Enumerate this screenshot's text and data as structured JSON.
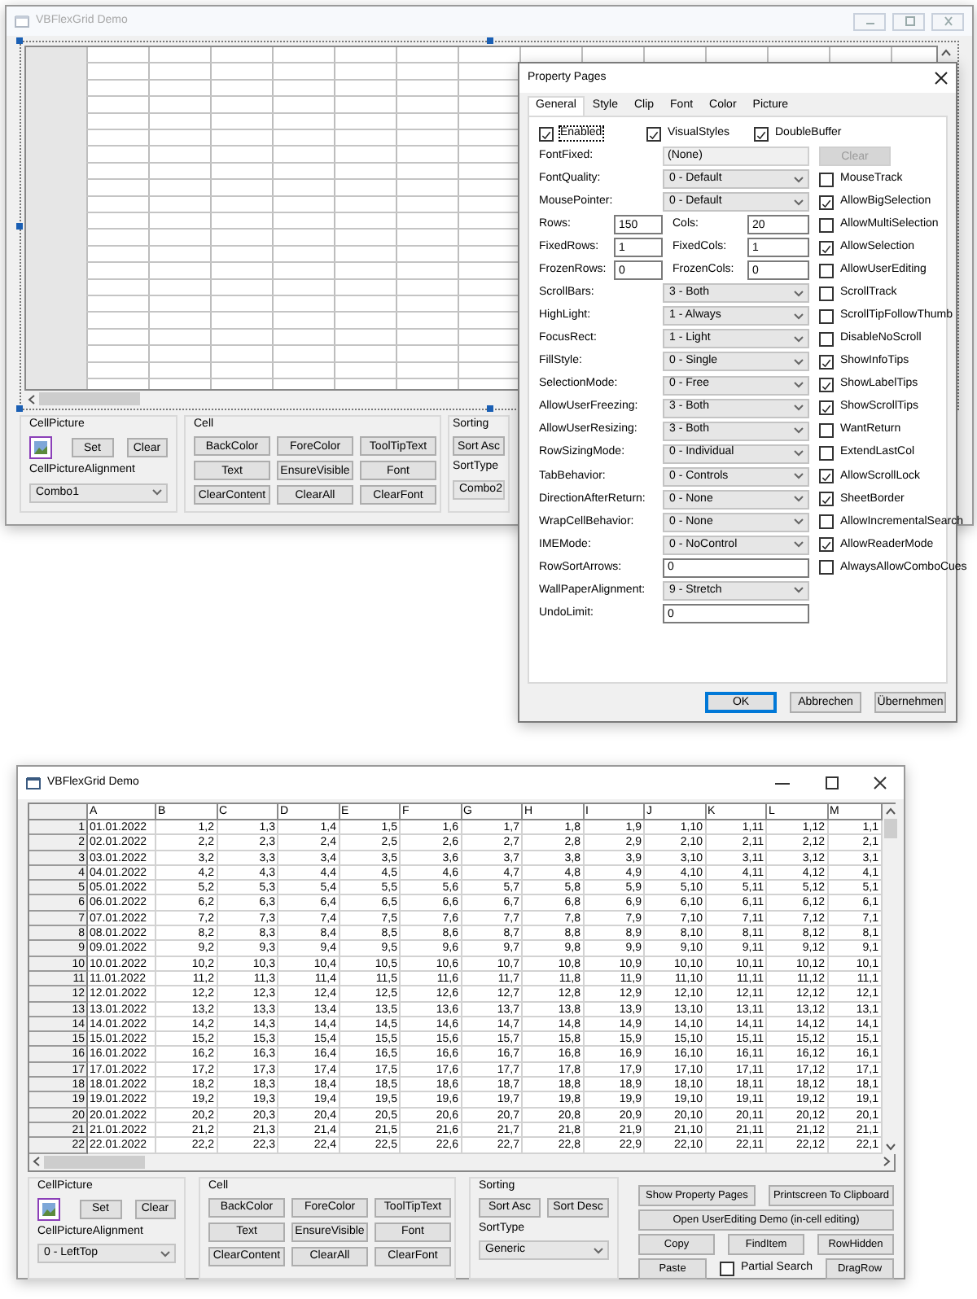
{
  "designer_window": {
    "title": "VBFlexGrid Demo",
    "cell_picture": {
      "label": "CellPicture",
      "buttons": [
        "Set",
        "Clear"
      ],
      "alignment_label": "CellPictureAlignment",
      "alignment_value": "Combo1"
    },
    "cell": {
      "label": "Cell",
      "buttons": [
        "BackColor",
        "ForeColor",
        "ToolTipText",
        "Text",
        "EnsureVisible",
        "Font",
        "ClearContent",
        "ClearAll",
        "ClearFont"
      ]
    },
    "sorting": {
      "label": "Sorting",
      "buttons": [
        "Sort Asc"
      ],
      "sort_type_label": "SortType",
      "sort_type_value": "Combo2"
    }
  },
  "property_pages": {
    "title": "Property Pages",
    "tabs": [
      {
        "label": "General",
        "selected": true
      },
      {
        "label": "Style",
        "selected": false
      },
      {
        "label": "Clip",
        "selected": false
      },
      {
        "label": "Font",
        "selected": false
      },
      {
        "label": "Color",
        "selected": false
      },
      {
        "label": "Picture",
        "selected": false
      }
    ],
    "top_checks": [
      {
        "label": "Enabled",
        "checked": true,
        "focused": true
      },
      {
        "label": "VisualStyles",
        "checked": true,
        "focused": false
      },
      {
        "label": "DoubleBuffer",
        "checked": true,
        "focused": false
      }
    ],
    "properties": [
      {
        "kind": "text",
        "label": "FontFixed:",
        "value": "(None)"
      },
      {
        "kind": "select",
        "label": "FontQuality:",
        "value": "0 - Default"
      },
      {
        "kind": "select",
        "label": "MousePointer:",
        "value": "0 - Default"
      },
      {
        "kind": "pair",
        "label": "Rows:",
        "value": "150",
        "label2": "Cols:",
        "value2": "20"
      },
      {
        "kind": "pair",
        "label": "FixedRows:",
        "value": "1",
        "label2": "FixedCols:",
        "value2": "1"
      },
      {
        "kind": "pair",
        "label": "FrozenRows:",
        "value": "0",
        "label2": "FrozenCols:",
        "value2": "0"
      },
      {
        "kind": "select",
        "label": "ScrollBars:",
        "value": "3 - Both"
      },
      {
        "kind": "select",
        "label": "HighLight:",
        "value": "1 - Always"
      },
      {
        "kind": "select",
        "label": "FocusRect:",
        "value": "1 - Light"
      },
      {
        "kind": "select",
        "label": "FillStyle:",
        "value": "0 - Single"
      },
      {
        "kind": "select",
        "label": "SelectionMode:",
        "value": "0 - Free"
      },
      {
        "kind": "select",
        "label": "AllowUserFreezing:",
        "value": "3 - Both"
      },
      {
        "kind": "select",
        "label": "AllowUserResizing:",
        "value": "3 - Both"
      },
      {
        "kind": "select",
        "label": "RowSizingMode:",
        "value": "0 - Individual"
      },
      {
        "kind": "select",
        "label": "TabBehavior:",
        "value": "0 - Controls"
      },
      {
        "kind": "select",
        "label": "DirectionAfterReturn:",
        "value": "0 - None"
      },
      {
        "kind": "select",
        "label": "WrapCellBehavior:",
        "value": "0 - None"
      },
      {
        "kind": "select",
        "label": "IMEMode:",
        "value": "0 - NoControl"
      },
      {
        "kind": "number",
        "label": "RowSortArrows:",
        "value": "0"
      },
      {
        "kind": "select",
        "label": "WallPaperAlignment:",
        "value": "9 - Stretch"
      },
      {
        "kind": "number",
        "label": "UndoLimit:",
        "value": "0"
      }
    ],
    "clear_button": {
      "label": "Clear",
      "disabled": true
    },
    "options": [
      {
        "label": "MouseTrack",
        "checked": false
      },
      {
        "label": "AllowBigSelection",
        "checked": true
      },
      {
        "label": "AllowMultiSelection",
        "checked": false
      },
      {
        "label": "AllowSelection",
        "checked": true
      },
      {
        "label": "AllowUserEditing",
        "checked": false
      },
      {
        "label": "ScrollTrack",
        "checked": false
      },
      {
        "label": "ScrollTipFollowThumb",
        "checked": false
      },
      {
        "label": "DisableNoScroll",
        "checked": false
      },
      {
        "label": "ShowInfoTips",
        "checked": true
      },
      {
        "label": "ShowLabelTips",
        "checked": true
      },
      {
        "label": "ShowScrollTips",
        "checked": true
      },
      {
        "label": "WantReturn",
        "checked": false
      },
      {
        "label": "ExtendLastCol",
        "checked": false
      },
      {
        "label": "AllowScrollLock",
        "checked": true
      },
      {
        "label": "SheetBorder",
        "checked": true
      },
      {
        "label": "AllowIncrementalSearch",
        "checked": false
      },
      {
        "label": "AllowReaderMode",
        "checked": true
      },
      {
        "label": "AlwaysAllowComboCues",
        "checked": false
      }
    ],
    "buttons": [
      {
        "label": "OK",
        "default": true
      },
      {
        "label": "Abbrechen",
        "default": false
      },
      {
        "label": "Übernehmen",
        "default": false
      }
    ]
  },
  "main_window": {
    "title": "VBFlexGrid Demo",
    "grid": {
      "columns": [
        "A",
        "B",
        "C",
        "D",
        "E",
        "F",
        "G",
        "H",
        "I",
        "J",
        "K",
        "L",
        "M"
      ],
      "rows": [
        {
          "header": "1",
          "cells": [
            "01.01.2022",
            "1,2",
            "1,3",
            "1,4",
            "1,5",
            "1,6",
            "1,7",
            "1,8",
            "1,9",
            "1,10",
            "1,11",
            "1,12",
            "1,1"
          ]
        },
        {
          "header": "2",
          "cells": [
            "02.01.2022",
            "2,2",
            "2,3",
            "2,4",
            "2,5",
            "2,6",
            "2,7",
            "2,8",
            "2,9",
            "2,10",
            "2,11",
            "2,12",
            "2,1"
          ]
        },
        {
          "header": "3",
          "cells": [
            "03.01.2022",
            "3,2",
            "3,3",
            "3,4",
            "3,5",
            "3,6",
            "3,7",
            "3,8",
            "3,9",
            "3,10",
            "3,11",
            "3,12",
            "3,1"
          ]
        },
        {
          "header": "4",
          "cells": [
            "04.01.2022",
            "4,2",
            "4,3",
            "4,4",
            "4,5",
            "4,6",
            "4,7",
            "4,8",
            "4,9",
            "4,10",
            "4,11",
            "4,12",
            "4,1"
          ]
        },
        {
          "header": "5",
          "cells": [
            "05.01.2022",
            "5,2",
            "5,3",
            "5,4",
            "5,5",
            "5,6",
            "5,7",
            "5,8",
            "5,9",
            "5,10",
            "5,11",
            "5,12",
            "5,1"
          ]
        },
        {
          "header": "6",
          "cells": [
            "06.01.2022",
            "6,2",
            "6,3",
            "6,4",
            "6,5",
            "6,6",
            "6,7",
            "6,8",
            "6,9",
            "6,10",
            "6,11",
            "6,12",
            "6,1"
          ]
        },
        {
          "header": "7",
          "cells": [
            "07.01.2022",
            "7,2",
            "7,3",
            "7,4",
            "7,5",
            "7,6",
            "7,7",
            "7,8",
            "7,9",
            "7,10",
            "7,11",
            "7,12",
            "7,1"
          ]
        },
        {
          "header": "8",
          "cells": [
            "08.01.2022",
            "8,2",
            "8,3",
            "8,4",
            "8,5",
            "8,6",
            "8,7",
            "8,8",
            "8,9",
            "8,10",
            "8,11",
            "8,12",
            "8,1"
          ]
        },
        {
          "header": "9",
          "cells": [
            "09.01.2022",
            "9,2",
            "9,3",
            "9,4",
            "9,5",
            "9,6",
            "9,7",
            "9,8",
            "9,9",
            "9,10",
            "9,11",
            "9,12",
            "9,1"
          ]
        },
        {
          "header": "10",
          "cells": [
            "10.01.2022",
            "10,2",
            "10,3",
            "10,4",
            "10,5",
            "10,6",
            "10,7",
            "10,8",
            "10,9",
            "10,10",
            "10,11",
            "10,12",
            "10,1"
          ]
        },
        {
          "header": "11",
          "cells": [
            "11.01.2022",
            "11,2",
            "11,3",
            "11,4",
            "11,5",
            "11,6",
            "11,7",
            "11,8",
            "11,9",
            "11,10",
            "11,11",
            "11,12",
            "11,1"
          ]
        },
        {
          "header": "12",
          "cells": [
            "12.01.2022",
            "12,2",
            "12,3",
            "12,4",
            "12,5",
            "12,6",
            "12,7",
            "12,8",
            "12,9",
            "12,10",
            "12,11",
            "12,12",
            "12,1"
          ]
        },
        {
          "header": "13",
          "cells": [
            "13.01.2022",
            "13,2",
            "13,3",
            "13,4",
            "13,5",
            "13,6",
            "13,7",
            "13,8",
            "13,9",
            "13,10",
            "13,11",
            "13,12",
            "13,1"
          ]
        },
        {
          "header": "14",
          "cells": [
            "14.01.2022",
            "14,2",
            "14,3",
            "14,4",
            "14,5",
            "14,6",
            "14,7",
            "14,8",
            "14,9",
            "14,10",
            "14,11",
            "14,12",
            "14,1"
          ]
        },
        {
          "header": "15",
          "cells": [
            "15.01.2022",
            "15,2",
            "15,3",
            "15,4",
            "15,5",
            "15,6",
            "15,7",
            "15,8",
            "15,9",
            "15,10",
            "15,11",
            "15,12",
            "15,1"
          ]
        },
        {
          "header": "16",
          "cells": [
            "16.01.2022",
            "16,2",
            "16,3",
            "16,4",
            "16,5",
            "16,6",
            "16,7",
            "16,8",
            "16,9",
            "16,10",
            "16,11",
            "16,12",
            "16,1"
          ]
        },
        {
          "header": "17",
          "cells": [
            "17.01.2022",
            "17,2",
            "17,3",
            "17,4",
            "17,5",
            "17,6",
            "17,7",
            "17,8",
            "17,9",
            "17,10",
            "17,11",
            "17,12",
            "17,1"
          ]
        },
        {
          "header": "18",
          "cells": [
            "18.01.2022",
            "18,2",
            "18,3",
            "18,4",
            "18,5",
            "18,6",
            "18,7",
            "18,8",
            "18,9",
            "18,10",
            "18,11",
            "18,12",
            "18,1"
          ]
        },
        {
          "header": "19",
          "cells": [
            "19.01.2022",
            "19,2",
            "19,3",
            "19,4",
            "19,5",
            "19,6",
            "19,7",
            "19,8",
            "19,9",
            "19,10",
            "19,11",
            "19,12",
            "19,1"
          ]
        },
        {
          "header": "20",
          "cells": [
            "20.01.2022",
            "20,2",
            "20,3",
            "20,4",
            "20,5",
            "20,6",
            "20,7",
            "20,8",
            "20,9",
            "20,10",
            "20,11",
            "20,12",
            "20,1"
          ]
        },
        {
          "header": "21",
          "cells": [
            "21.01.2022",
            "21,2",
            "21,3",
            "21,4",
            "21,5",
            "21,6",
            "21,7",
            "21,8",
            "21,9",
            "21,10",
            "21,11",
            "21,12",
            "21,1"
          ]
        },
        {
          "header": "22",
          "cells": [
            "22.01.2022",
            "22,2",
            "22,3",
            "22,4",
            "22,5",
            "22,6",
            "22,7",
            "22,8",
            "22,9",
            "22,10",
            "22,11",
            "22,12",
            "22,1"
          ]
        }
      ]
    },
    "cell_picture": {
      "label": "CellPicture",
      "buttons": [
        "Set",
        "Clear"
      ],
      "alignment_label": "CellPictureAlignment",
      "alignment_value": "0 - LeftTop"
    },
    "cell": {
      "label": "Cell",
      "buttons": [
        "BackColor",
        "ForeColor",
        "ToolTipText",
        "Text",
        "EnsureVisible",
        "Font",
        "ClearContent",
        "ClearAll",
        "ClearFont"
      ]
    },
    "sorting": {
      "label": "Sorting",
      "buttons": [
        "Sort Asc",
        "Sort Desc"
      ],
      "sort_type_label": "SortType",
      "sort_type_value": "Generic"
    },
    "action_rows": [
      [
        {
          "kind": "button",
          "label": "Show Property Pages"
        },
        {
          "kind": "button",
          "label": "Printscreen To Clipboard"
        }
      ],
      [
        {
          "kind": "button",
          "label": "Open UserEditing Demo (in-cell editing)"
        }
      ],
      [
        {
          "kind": "button",
          "label": "Copy"
        },
        {
          "kind": "button",
          "label": "FindItem"
        },
        {
          "kind": "button",
          "label": "RowHidden"
        }
      ],
      [
        {
          "kind": "button",
          "label": "Paste"
        },
        {
          "kind": "checkbox",
          "label": "Partial Search",
          "checked": false
        },
        {
          "kind": "button",
          "label": "DragRow"
        }
      ]
    ]
  }
}
